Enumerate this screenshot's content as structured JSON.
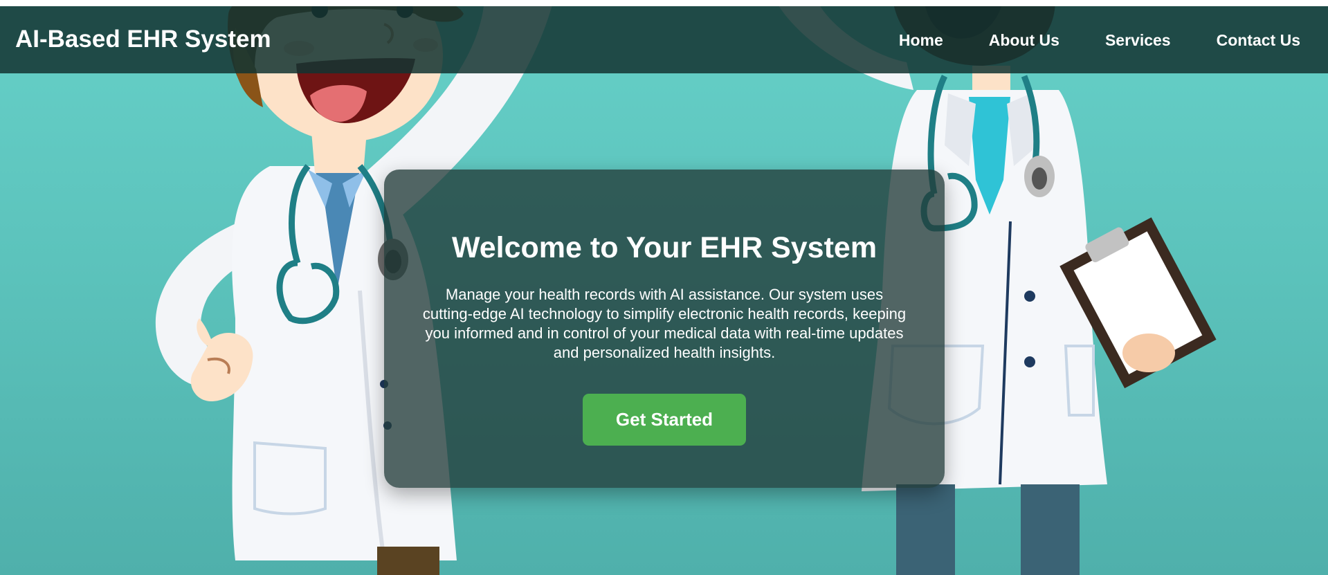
{
  "header": {
    "brand": "AI-Based EHR System",
    "nav": [
      {
        "label": "Home"
      },
      {
        "label": "About Us"
      },
      {
        "label": "Services"
      },
      {
        "label": "Contact Us"
      }
    ]
  },
  "hero": {
    "title": "Welcome to Your EHR System",
    "description": "Manage your health records with AI assistance. Our system uses cutting-edge AI technology to simplify electronic health records, keeping you informed and in control of your medical data with real-time updates and personalized health insights.",
    "cta_label": "Get Started"
  },
  "colors": {
    "background": "#5cc3bc",
    "navbar": "#1f3d3b",
    "card": "#233c3a",
    "cta": "#4caf50",
    "text": "#ffffff"
  }
}
